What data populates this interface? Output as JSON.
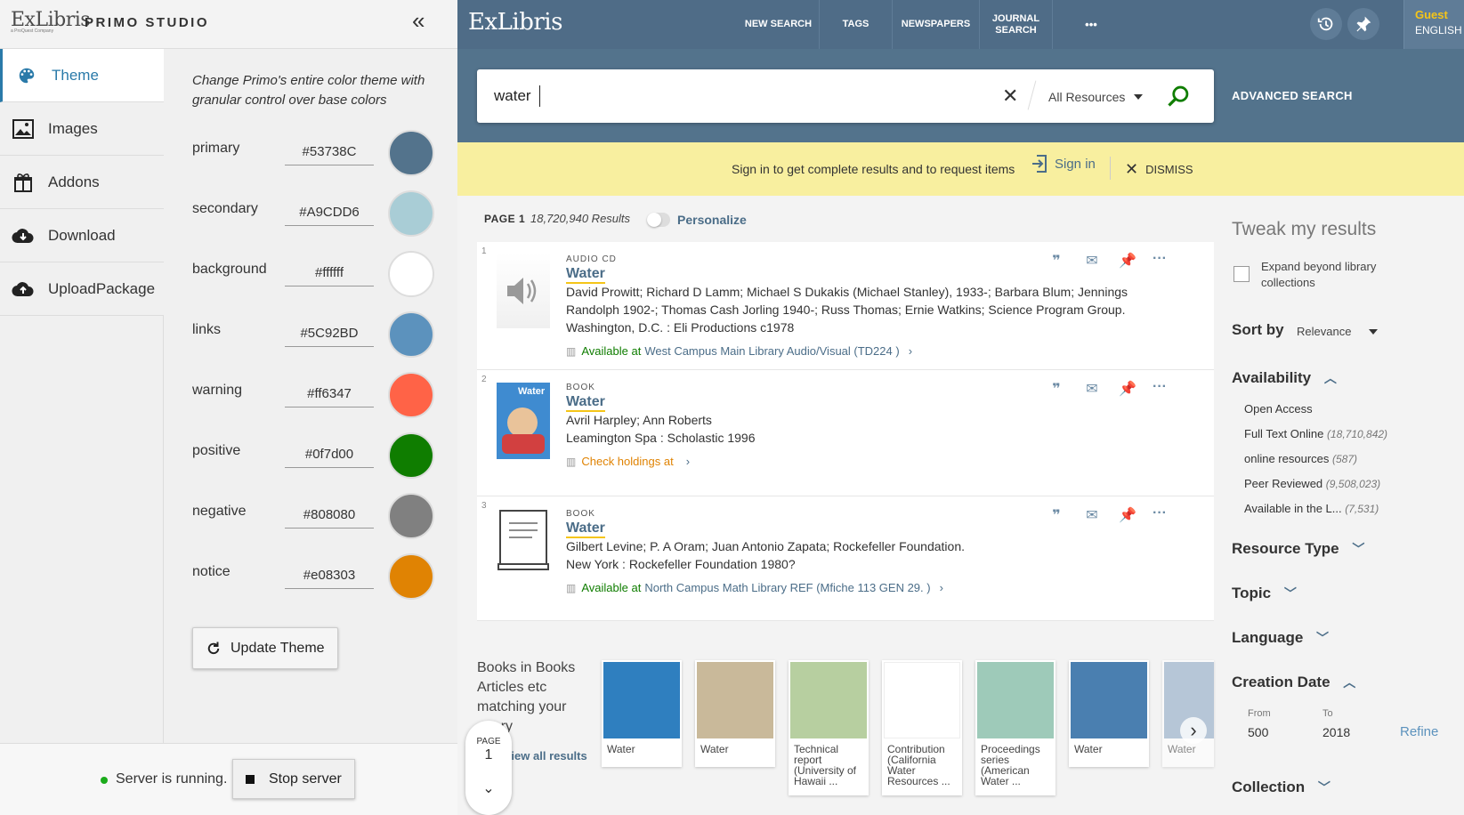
{
  "studio": {
    "brand": "ExLibris",
    "brand_sub": "a ProQuest Company",
    "title": "PRIMO STUDIO",
    "collapse_label": "«",
    "nav": [
      {
        "label": "Theme",
        "icon": "palette-icon"
      },
      {
        "label": "Images",
        "icon": "image-icon"
      },
      {
        "label": "Addons",
        "icon": "gift-icon"
      },
      {
        "label": "Download",
        "icon": "cloud-download-icon"
      },
      {
        "label": "UploadPackage",
        "icon": "cloud-upload-icon"
      }
    ],
    "theme_description": "Change Primo's entire color theme with granular control over base colors",
    "colors": [
      {
        "name": "primary",
        "value": "#53738C",
        "swatch": "#53738c"
      },
      {
        "name": "secondary",
        "value": "#A9CDD6",
        "swatch": "#a9cdd6"
      },
      {
        "name": "background",
        "value": "#ffffff",
        "swatch": "#ffffff"
      },
      {
        "name": "links",
        "value": "#5C92BD",
        "swatch": "#5c92bd"
      },
      {
        "name": "warning",
        "value": "#ff6347",
        "swatch": "#ff6347"
      },
      {
        "name": "positive",
        "value": "#0f7d00",
        "swatch": "#0f7d00"
      },
      {
        "name": "negative",
        "value": "#808080",
        "swatch": "#808080"
      },
      {
        "name": "notice",
        "value": "#e08303",
        "swatch": "#e08303"
      }
    ],
    "update_button": "Update Theme",
    "server_status": "Server is running.",
    "stop_button": "Stop server"
  },
  "primo": {
    "logo": "ExLibris",
    "topnav": [
      "NEW SEARCH",
      "TAGS",
      "NEWSPAPERS",
      "JOURNAL SEARCH"
    ],
    "more": "•••",
    "guest": "Guest",
    "language": "ENGLISH",
    "search_value": "water",
    "scope": "All Resources",
    "advanced_search": "ADVANCED SEARCH",
    "signin_message": "Sign in to get complete results and to request items",
    "signin_link": "Sign in",
    "dismiss": "DISMISS",
    "page_label": "PAGE 1",
    "results_count": "18,720,940 Results",
    "personalize": "Personalize",
    "results": [
      {
        "num": "1",
        "type": "AUDIO CD",
        "title": "Water",
        "lines": [
          "David Prowitt; Richard D Lamm; Michael S Dukakis (Michael Stanley), 1933-; Barbara Blum; Jennings",
          "Randolph 1902-; Thomas Cash Jorling 1940-; Russ Thomas; Ernie Watkins; Science Program Group.",
          "Washington, D.C. : Eli Productions c1978"
        ],
        "avail_status": "Available at",
        "avail_location": "West Campus Main Library  Audio/Visual (TD224 )"
      },
      {
        "num": "2",
        "type": "BOOK",
        "title": "Water",
        "lines": [
          "Avril Harpley; Ann Roberts",
          "Leamington Spa : Scholastic 1996"
        ],
        "avail_status": "Check holdings at",
        "avail_location": ""
      },
      {
        "num": "3",
        "type": "BOOK",
        "title": "Water",
        "lines": [
          "Gilbert Levine; P. A Oram; Juan Antonio Zapata; Rockefeller Foundation.",
          "New York : Rockefeller Foundation 1980?"
        ],
        "avail_status": "Available at",
        "avail_location": "North Campus Math Library  REF (Mfiche 113 GEN 29. )"
      }
    ],
    "books_heading": "Books in Books Articles etc matching your query",
    "view_all": "View all results",
    "page_badge_label": "PAGE",
    "page_badge_num": "1",
    "carousel": [
      {
        "caption": "Water",
        "color": "#2f7fbf"
      },
      {
        "caption": "Water",
        "color": "#c9b99a"
      },
      {
        "caption": "Technical report (University of Hawaii ...",
        "color": "#b7cfa0"
      },
      {
        "caption": "Contribution (California Water Resources ...",
        "color": "#ffffff"
      },
      {
        "caption": "Proceedings series (American Water ...",
        "color": "#9ecab9"
      },
      {
        "caption": "Water",
        "color": "#4a7fb0"
      },
      {
        "caption": "Water",
        "color": "#8fa9c6"
      }
    ],
    "tweak": {
      "heading": "Tweak my results",
      "expand_label": "Expand beyond library collections",
      "sort_label": "Sort by",
      "sort_value": "Relevance",
      "availability": "Availability",
      "availability_items": [
        {
          "label": "Open Access",
          "count": ""
        },
        {
          "label": "Full Text Online",
          "count": "(18,710,842)"
        },
        {
          "label": "online resources",
          "count": "(587)"
        },
        {
          "label": "Peer Reviewed",
          "count": "(9,508,023)"
        },
        {
          "label": "Available in the L...",
          "count": "(7,531)"
        }
      ],
      "resource_type": "Resource Type",
      "topic": "Topic",
      "language": "Language",
      "creation_date": "Creation Date",
      "from_label": "From",
      "from_value": "500",
      "to_label": "To",
      "to_value": "2018",
      "refine": "Refine",
      "collection": "Collection"
    }
  }
}
